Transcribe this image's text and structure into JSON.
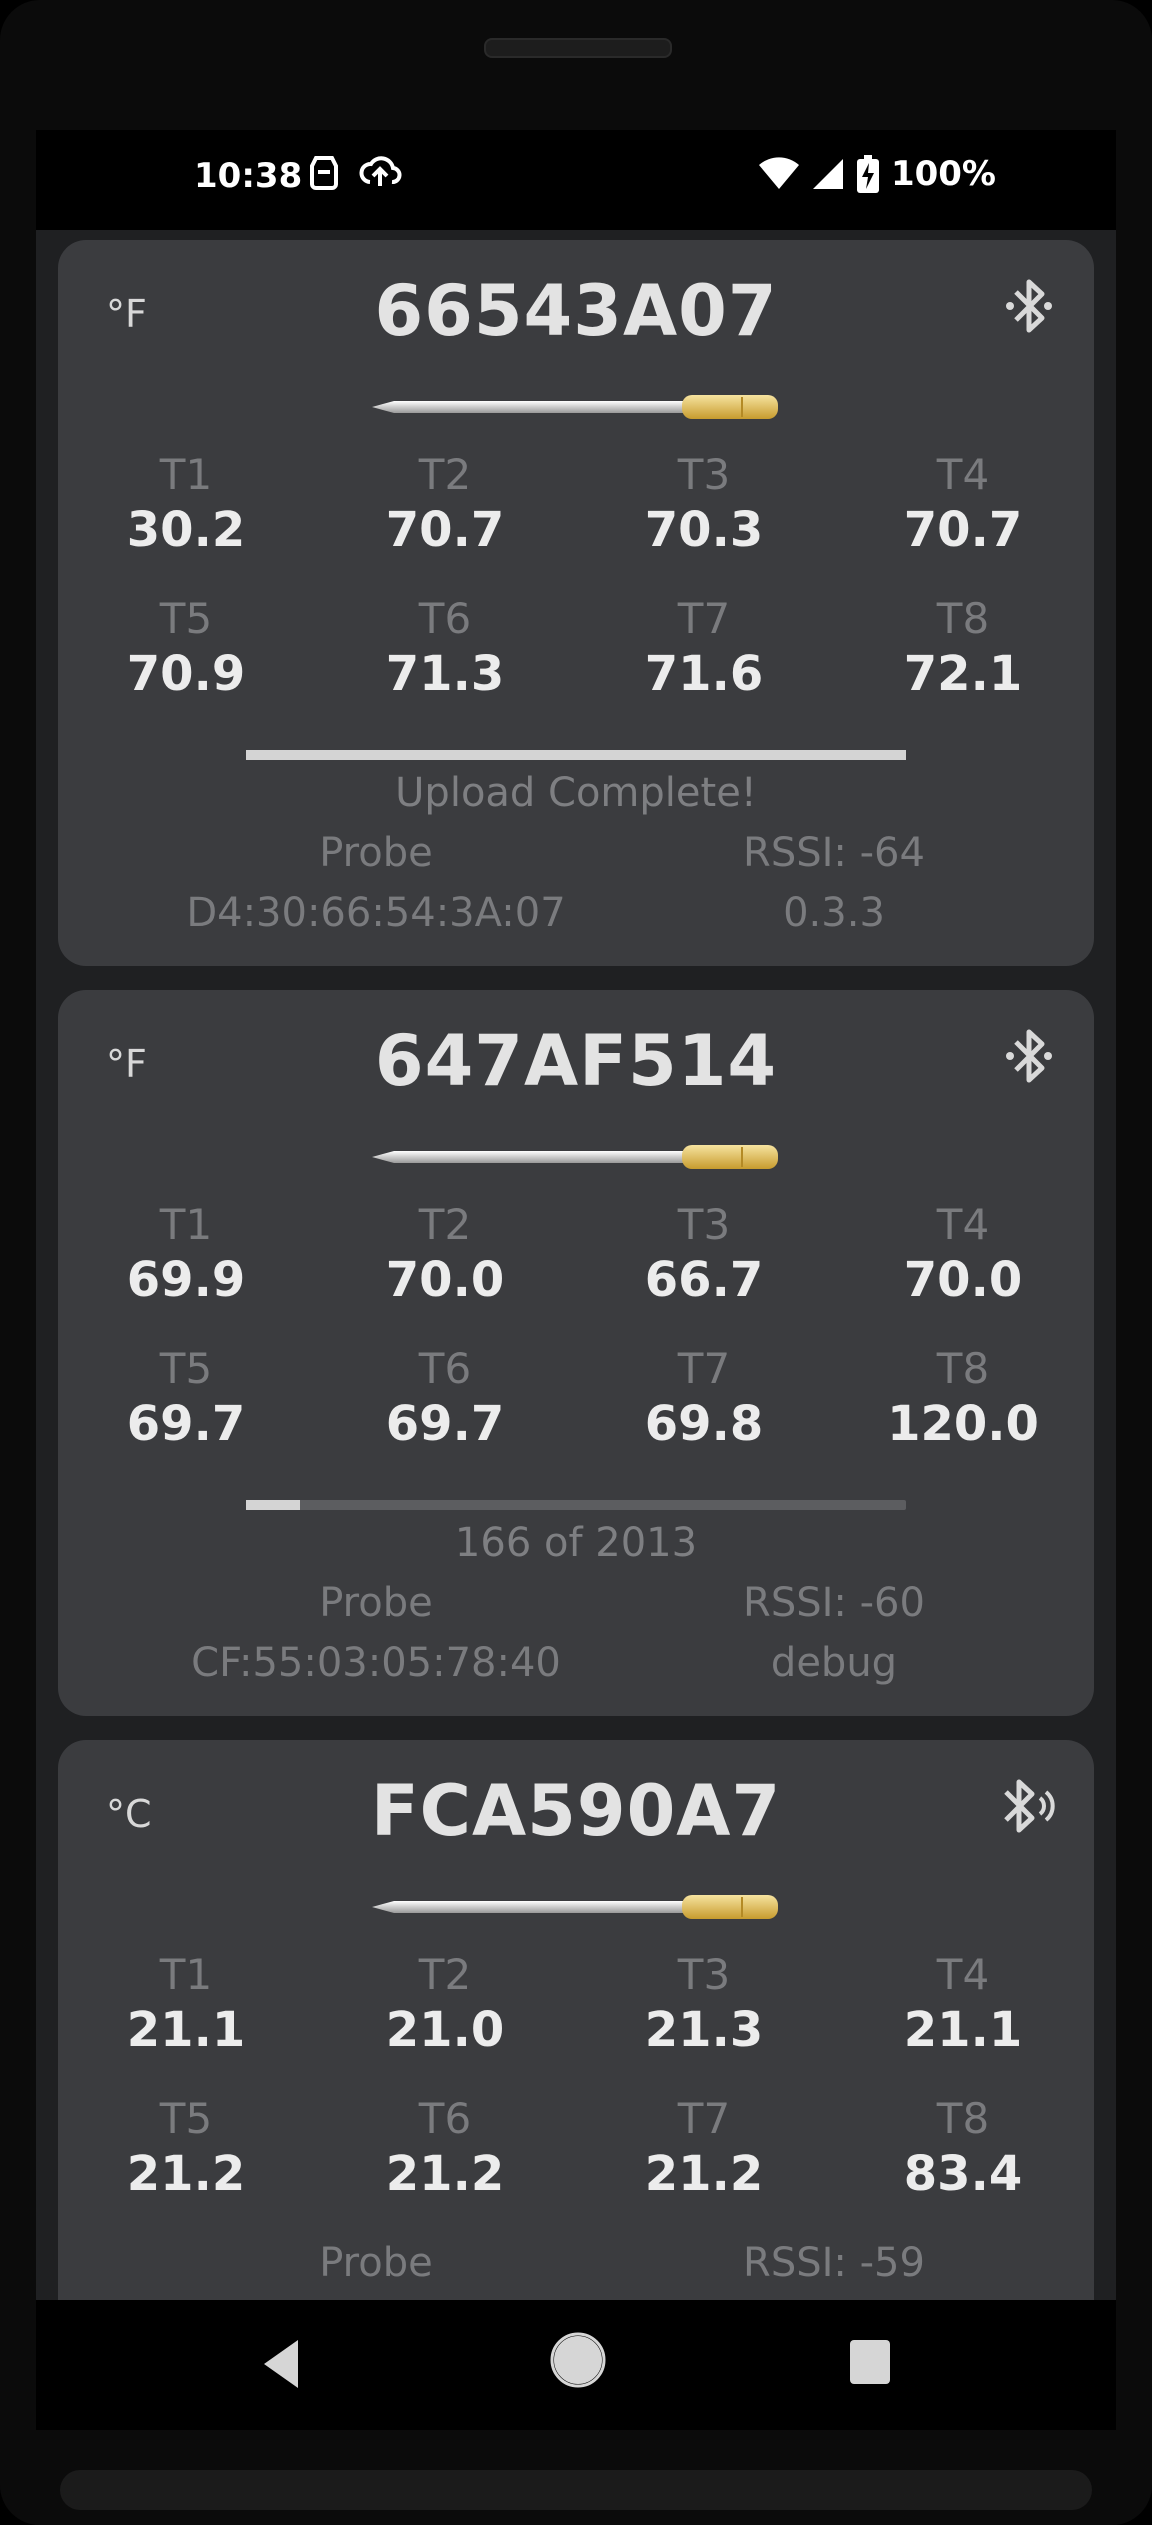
{
  "status": {
    "time": "10:38",
    "battery": "100%"
  },
  "colors": {
    "card": "#3b3c3f",
    "background": "#1f2022",
    "value_text": "#ececec",
    "label_text": "#7a7b7e",
    "probe_tip": "#e4c35a"
  },
  "probes": [
    {
      "unit": "°F",
      "id": "66543A07",
      "bt_icon": "bluetooth-icon",
      "temps": [
        {
          "label": "T1",
          "value": "30.2"
        },
        {
          "label": "T2",
          "value": "70.7"
        },
        {
          "label": "T3",
          "value": "70.3"
        },
        {
          "label": "T4",
          "value": "70.7"
        },
        {
          "label": "T5",
          "value": "70.9"
        },
        {
          "label": "T6",
          "value": "71.3"
        },
        {
          "label": "T7",
          "value": "71.6"
        },
        {
          "label": "T8",
          "value": "72.1"
        }
      ],
      "progress_fraction": 1.0,
      "progress_text": "Upload Complete!",
      "type": "Probe",
      "rssi": "RSSI: -64",
      "mac": "D4:30:66:54:3A:07",
      "firmware": "0.3.3"
    },
    {
      "unit": "°F",
      "id": "647AF514",
      "bt_icon": "bluetooth-icon",
      "temps": [
        {
          "label": "T1",
          "value": "69.9"
        },
        {
          "label": "T2",
          "value": "70.0"
        },
        {
          "label": "T3",
          "value": "66.7"
        },
        {
          "label": "T4",
          "value": "70.0"
        },
        {
          "label": "T5",
          "value": "69.7"
        },
        {
          "label": "T6",
          "value": "69.7"
        },
        {
          "label": "T7",
          "value": "69.8"
        },
        {
          "label": "T8",
          "value": "120.0"
        }
      ],
      "progress_fraction": 0.0823,
      "progress_text": "166 of 2013",
      "type": "Probe",
      "rssi": "RSSI: -60",
      "mac": "CF:55:03:05:78:40",
      "firmware": "debug"
    },
    {
      "unit": "°C",
      "id": "FCA590A7",
      "bt_icon": "bluetooth-searching-icon",
      "temps": [
        {
          "label": "T1",
          "value": "21.1"
        },
        {
          "label": "T2",
          "value": "21.0"
        },
        {
          "label": "T3",
          "value": "21.3"
        },
        {
          "label": "T4",
          "value": "21.1"
        },
        {
          "label": "T5",
          "value": "21.2"
        },
        {
          "label": "T6",
          "value": "21.2"
        },
        {
          "label": "T7",
          "value": "21.2"
        },
        {
          "label": "T8",
          "value": "83.4"
        }
      ],
      "type": "Probe",
      "rssi": "RSSI: -59"
    }
  ]
}
